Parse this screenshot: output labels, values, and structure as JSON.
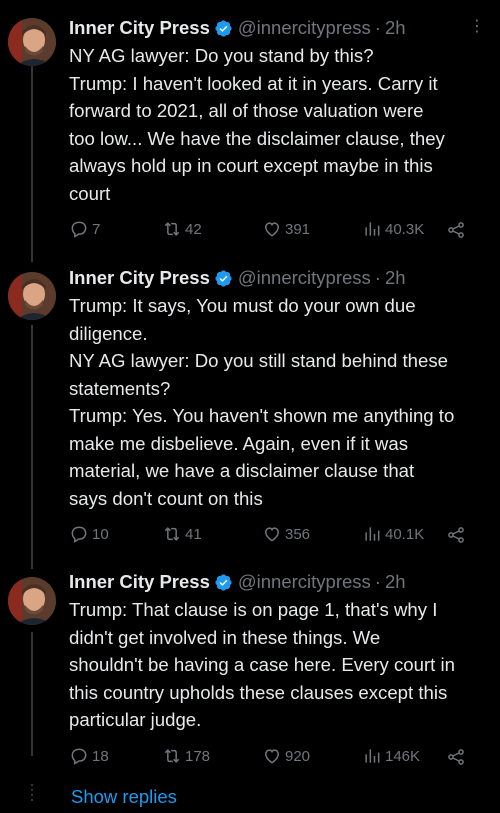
{
  "tweets": [
    {
      "name": "Inner City Press",
      "handle": "@innercitypress",
      "time": "2h",
      "lines": [
        "NY AG lawyer: Do you stand by this?",
        "Trump: I haven't looked at it in years. Carry it",
        "forward to 2021, all of those valuation were",
        "too low... We have the disclaimer clause, they",
        "always hold up in court except maybe in this",
        "court"
      ],
      "replies": "7",
      "reposts": "42",
      "likes": "391",
      "views": "40.3K"
    },
    {
      "name": "Inner City Press",
      "handle": "@innercitypress",
      "time": "2h",
      "lines": [
        "Trump: It says, You must do your own due",
        "diligence.",
        "NY AG lawyer: Do you still stand behind these",
        "statements?",
        "Trump: Yes. You haven't shown me anything to",
        "make me disbelieve. Again, even if it was",
        "material, we have a disclaimer clause that",
        "says don't count on this"
      ],
      "replies": "10",
      "reposts": "41",
      "likes": "356",
      "views": "40.1K"
    },
    {
      "name": "Inner City Press",
      "handle": "@innercitypress",
      "time": "2h",
      "lines": [
        "Trump: That clause is on page 1, that's why I",
        "didn't get involved in these things. We",
        "shouldn't be having a case here. Every court in",
        "this country upholds these clauses except this",
        "particular judge."
      ],
      "replies": "18",
      "reposts": "178",
      "likes": "920",
      "views": "146K"
    }
  ],
  "show_replies_label": "Show replies",
  "colors": {
    "background": "#000000",
    "text": "#e7e9ea",
    "muted": "#71767b",
    "link": "#1d9bf0",
    "verified": "#1d9bf0",
    "thread_line": "#333639"
  },
  "icons": [
    "reply-icon",
    "repost-icon",
    "like-icon",
    "views-icon",
    "share-icon",
    "verified-badge-icon",
    "more-icon"
  ]
}
